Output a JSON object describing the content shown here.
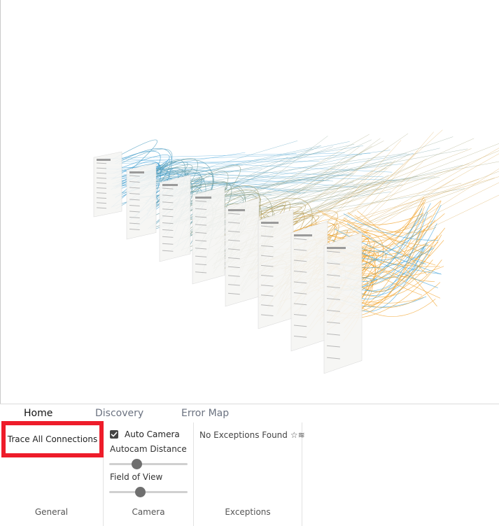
{
  "ribbon": {
    "tabs": [
      {
        "label": "Home",
        "active": true
      },
      {
        "label": "Discovery",
        "active": false
      },
      {
        "label": "Error Map",
        "active": false
      }
    ],
    "general": {
      "trace_button_label": "Trace All Connections",
      "group_label": "General"
    },
    "camera": {
      "auto_camera_label": "Auto Camera",
      "auto_camera_checked": true,
      "autocam_distance_label": "Autocam Distance",
      "autocam_distance_value": 0.35,
      "field_of_view_label": "Field of View",
      "field_of_view_value": 0.39,
      "group_label": "Camera"
    },
    "exceptions": {
      "status_text": "No Exceptions Found",
      "status_icon": "sparkle-icon",
      "group_label": "Exceptions"
    }
  },
  "visualization": {
    "description_colors": {
      "blue": "#3a9fd8",
      "orange": "#f2a32b",
      "page": "#f4f4f4"
    },
    "highlight_color": "#ee1c2a"
  }
}
